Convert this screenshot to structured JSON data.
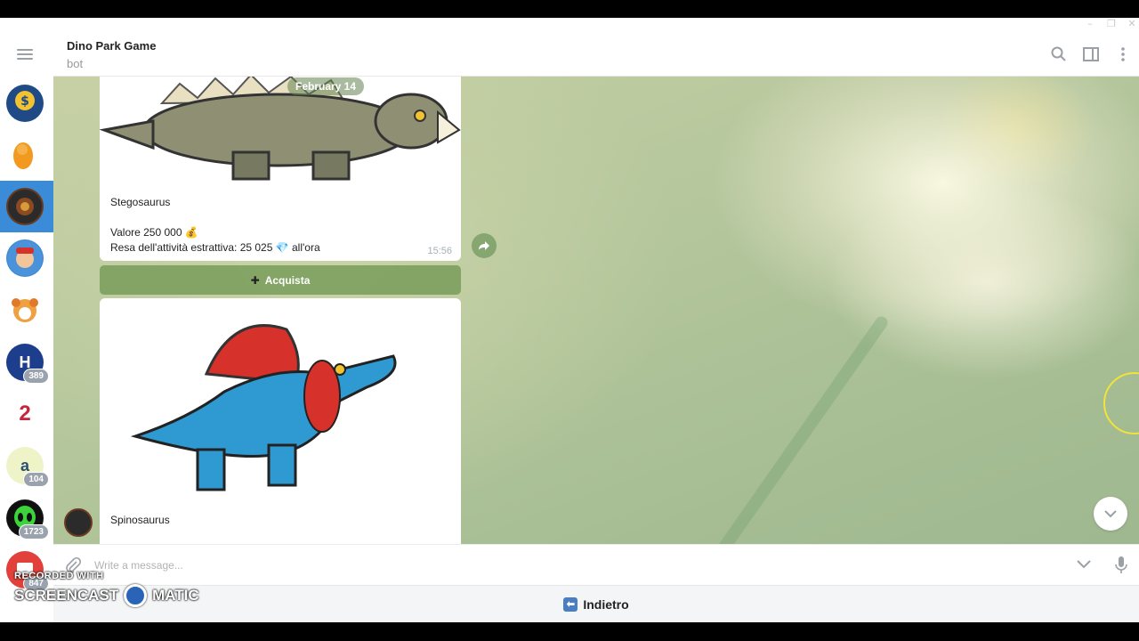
{
  "window_controls": {
    "minimize": "–",
    "restore": "❐",
    "close": "✕"
  },
  "chat": {
    "title": "Dino Park Game",
    "subtitle": "bot"
  },
  "sidebar": {
    "badges": [
      "389",
      "104",
      "1723",
      "847"
    ]
  },
  "messages": [
    {
      "date": "February 14",
      "name": "Stegosaurus",
      "value_line": "Valore 250 000 💰",
      "yield_line": "Resa dell'attività estrattiva: 25 025 💎 all'ora",
      "time": "15:56"
    },
    {
      "name": "Spinosaurus"
    }
  ],
  "buy_button": {
    "icon": "✚",
    "label": "Acquista"
  },
  "composer": {
    "placeholder": "Write a message..."
  },
  "keyboard": {
    "back_label": "Indietro",
    "back_icon": "⬅"
  },
  "watermark": {
    "line1": "RECORDED WITH",
    "line2a": "SCREENCAST",
    "line2b": "MATIC"
  },
  "colors": {
    "active_chat": "#3a8bd8",
    "buy_button": "#6e9650",
    "accent": "#4a7ec2"
  }
}
